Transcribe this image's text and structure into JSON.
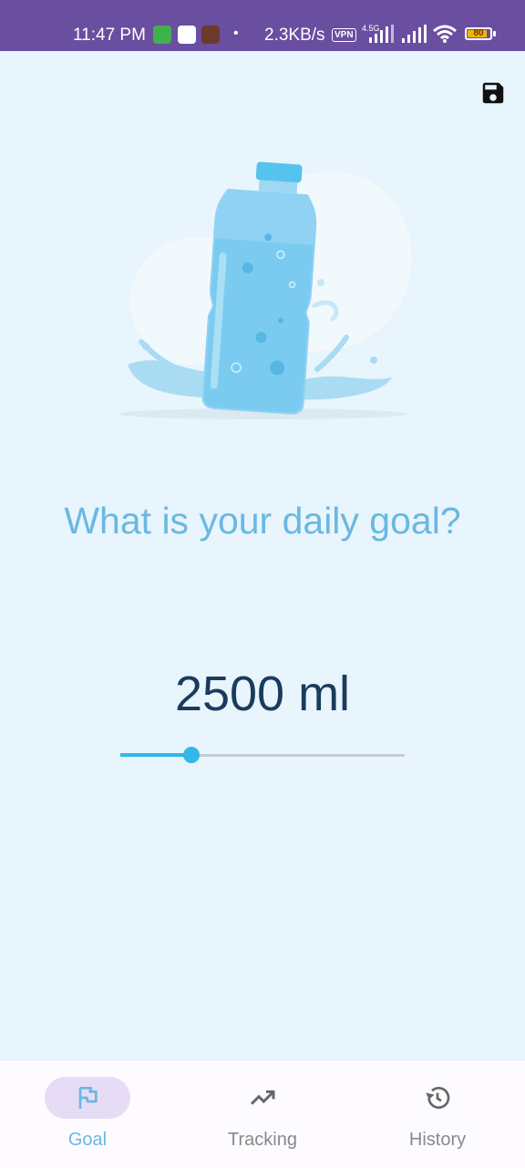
{
  "status_bar": {
    "time": "11:47 PM",
    "speed": "2.3KB/s",
    "vpn": "VPN",
    "network": "4.5G",
    "battery": "80"
  },
  "toolbar": {
    "save_icon": "save-icon"
  },
  "main": {
    "question": "What is your daily goal?",
    "goal_value": "2500 ml",
    "slider_fraction": 0.25
  },
  "nav": {
    "items": [
      {
        "label": "Goal",
        "icon": "flag-icon",
        "active": true
      },
      {
        "label": "Tracking",
        "icon": "trending-up-icon",
        "active": false
      },
      {
        "label": "History",
        "icon": "history-icon",
        "active": false
      }
    ]
  },
  "colors": {
    "status_bar": "#6a4ea0",
    "background": "#e8f5fc",
    "question_text": "#6ab8e2",
    "value_text": "#1a3b5c",
    "slider_accent": "#33b6ea",
    "nav_active_pill": "#e6dcf6"
  }
}
